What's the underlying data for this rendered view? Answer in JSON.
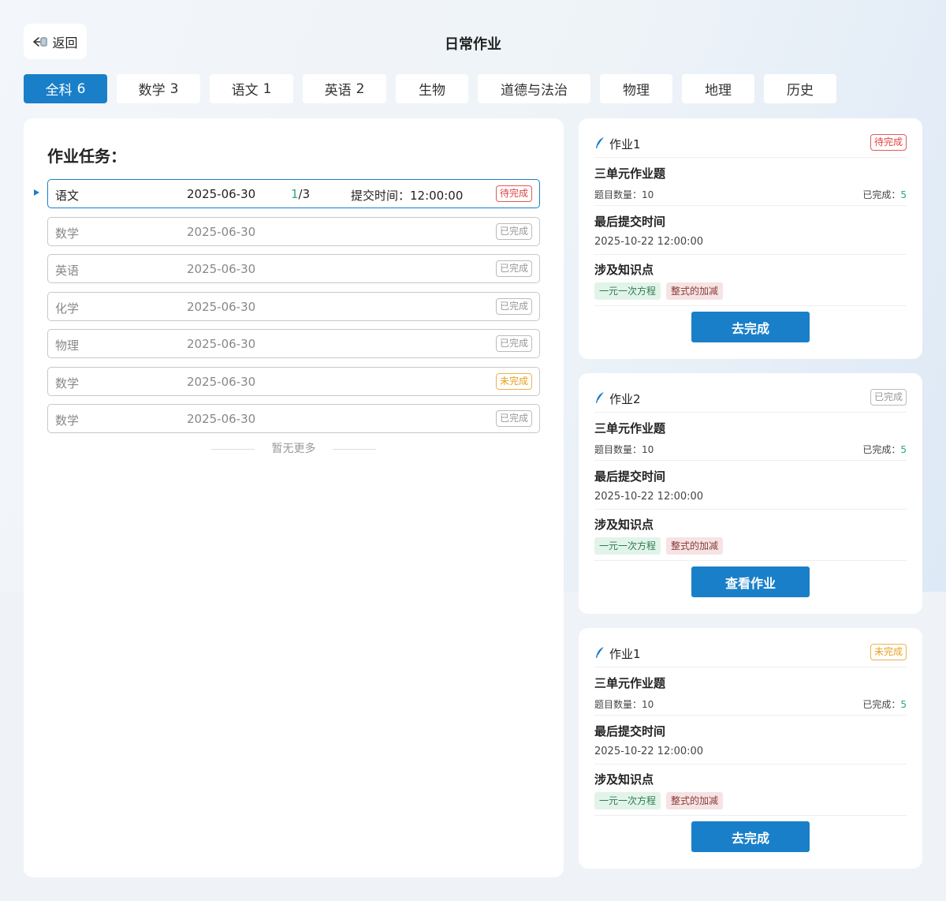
{
  "header": {
    "back_label": "返回",
    "back_icon": "arrow-left-icon",
    "title": "日常作业"
  },
  "tabs": [
    {
      "label": "全科",
      "count": "6",
      "active": true
    },
    {
      "label": "数学",
      "count": "3",
      "active": false
    },
    {
      "label": "语文",
      "count": "1",
      "active": false
    },
    {
      "label": "英语",
      "count": "2",
      "active": false
    },
    {
      "label": "生物",
      "count": "",
      "active": false
    },
    {
      "label": "道德与法治",
      "count": "",
      "active": false
    },
    {
      "label": "物理",
      "count": "",
      "active": false
    },
    {
      "label": "地理",
      "count": "",
      "active": false
    },
    {
      "label": "历史",
      "count": "",
      "active": false
    }
  ],
  "task_panel": {
    "title": "作业任务：",
    "no_more": "暂无更多",
    "tasks": [
      {
        "subject": "语文",
        "date": "2025-06-30",
        "progress_done": "1",
        "progress_total": "/3",
        "submit_time": "提交时间：12:00:00",
        "status": "待完成",
        "status_type": "pending",
        "active": true
      },
      {
        "subject": "数学",
        "date": "2025-06-30",
        "status": "已完成",
        "status_type": "done",
        "active": false
      },
      {
        "subject": "英语",
        "date": "2025-06-30",
        "status": "已完成",
        "status_type": "done",
        "active": false
      },
      {
        "subject": "化学",
        "date": "2025-06-30",
        "status": "已完成",
        "status_type": "done",
        "active": false
      },
      {
        "subject": "物理",
        "date": "2025-06-30",
        "status": "已完成",
        "status_type": "done",
        "active": false
      },
      {
        "subject": "数学",
        "date": "2025-06-30",
        "status": "未完成",
        "status_type": "undone",
        "active": false
      },
      {
        "subject": "数学",
        "date": "2025-06-30",
        "status": "已完成",
        "status_type": "done",
        "active": false
      }
    ]
  },
  "cards": [
    {
      "name": "作业1",
      "status": "待完成",
      "status_type": "pending",
      "subtitle": "三单元作业题",
      "question_label": "题目数量：",
      "question_count": "10",
      "completed_label": "已完成：",
      "completed_count": "5",
      "deadline_title": "最后提交时间",
      "deadline": "2025-10-22 12:00:00",
      "kp_title": "涉及知识点",
      "kp_tags": [
        "一元一次方程",
        "整式的加减"
      ],
      "action": "去完成"
    },
    {
      "name": "作业2",
      "status": "已完成",
      "status_type": "done",
      "subtitle": "三单元作业题",
      "question_label": "题目数量：",
      "question_count": "10",
      "completed_label": "已完成：",
      "completed_count": "5",
      "deadline_title": "最后提交时间",
      "deadline": "2025-10-22 12:00:00",
      "kp_title": "涉及知识点",
      "kp_tags": [
        "一元一次方程",
        "整式的加减"
      ],
      "action": "查看作业"
    },
    {
      "name": "作业1",
      "status": "未完成",
      "status_type": "undone",
      "subtitle": "三单元作业题",
      "question_label": "题目数量：",
      "question_count": "10",
      "completed_label": "已完成：",
      "completed_count": "5",
      "deadline_title": "最后提交时间",
      "deadline": "2025-10-22 12:00:00",
      "kp_title": "涉及知识点",
      "kp_tags": [
        "一元一次方程",
        "整式的加减"
      ],
      "action": "去完成"
    }
  ],
  "colors": {
    "accent": "#1a7fc9",
    "pending": "#e04444",
    "undone": "#e6a020",
    "done_gray": "#999999",
    "success": "#2aa87a"
  }
}
